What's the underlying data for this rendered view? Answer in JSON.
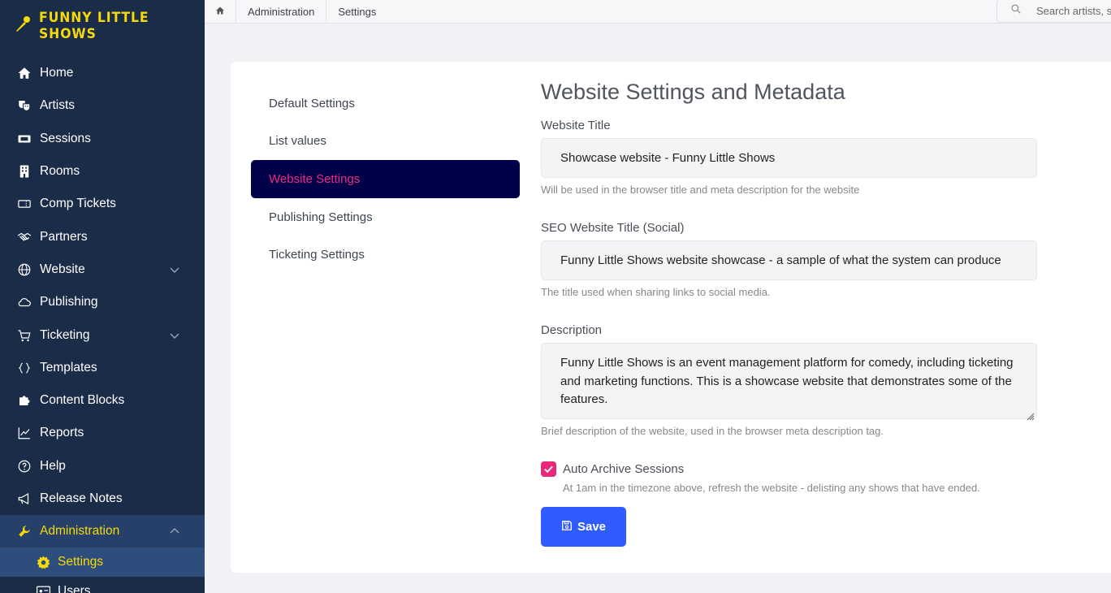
{
  "app": {
    "brand": "FUNNY LITTLE SHOWS",
    "brand_color": "#f5d90a",
    "sidebar_bg": "#1b2c48"
  },
  "sidebar": {
    "items": [
      {
        "label": "Home",
        "icon": "home-icon"
      },
      {
        "label": "Artists",
        "icon": "masks-icon"
      },
      {
        "label": "Sessions",
        "icon": "ticket-icon"
      },
      {
        "label": "Rooms",
        "icon": "building-icon"
      },
      {
        "label": "Comp Tickets",
        "icon": "ticket-outline-icon"
      },
      {
        "label": "Partners",
        "icon": "handshake-icon"
      },
      {
        "label": "Website",
        "icon": "globe-icon",
        "expandable": true
      },
      {
        "label": "Publishing",
        "icon": "cloud-icon"
      },
      {
        "label": "Ticketing",
        "icon": "cart-icon",
        "expandable": true
      },
      {
        "label": "Templates",
        "icon": "braces-icon"
      },
      {
        "label": "Content Blocks",
        "icon": "puzzle-icon"
      },
      {
        "label": "Reports",
        "icon": "chart-line-icon"
      },
      {
        "label": "Help",
        "icon": "question-icon"
      },
      {
        "label": "Release Notes",
        "icon": "megaphone-icon"
      },
      {
        "label": "Administration",
        "icon": "wrench-icon",
        "expanded": true,
        "active": true
      }
    ],
    "sub_items": [
      {
        "label": "Settings",
        "icon": "gear-icon",
        "active": true
      },
      {
        "label": "Users",
        "icon": "users-icon"
      }
    ]
  },
  "breadcrumb": {
    "items": [
      "Administration",
      "Settings"
    ]
  },
  "search": {
    "placeholder": "Search artists, sessions..."
  },
  "settings_menu": {
    "items": [
      "Default Settings",
      "List values",
      "Website Settings",
      "Publishing Settings",
      "Ticketing Settings"
    ],
    "active_index": 2
  },
  "form": {
    "heading": "Website Settings and Metadata",
    "website_title_label": "Website Title",
    "website_title_value": "Showcase website - Funny Little Shows",
    "website_title_help": "Will be used in the browser title and meta description for the website",
    "seo_title_label": "SEO Website Title (Social)",
    "seo_title_value": "Funny Little Shows website showcase - a sample of what the system can produce",
    "seo_title_help": "The title used when sharing links to social media.",
    "description_label": "Description",
    "description_value": "Funny Little Shows is an event management platform for comedy, including ticketing and marketing functions. This is a showcase website that demonstrates some of the features.",
    "description_help": "Brief description of the website, used in the browser meta description tag.",
    "auto_archive_label": "Auto Archive Sessions",
    "auto_archive_checked": true,
    "auto_archive_help": "At 1am in the timezone above, refresh the website - delisting any shows that have ended.",
    "save_label": "Save"
  },
  "colors": {
    "accent_pink": "#e8287a",
    "active_menu_bg": "#00004a",
    "primary_button": "#2f5bff"
  }
}
